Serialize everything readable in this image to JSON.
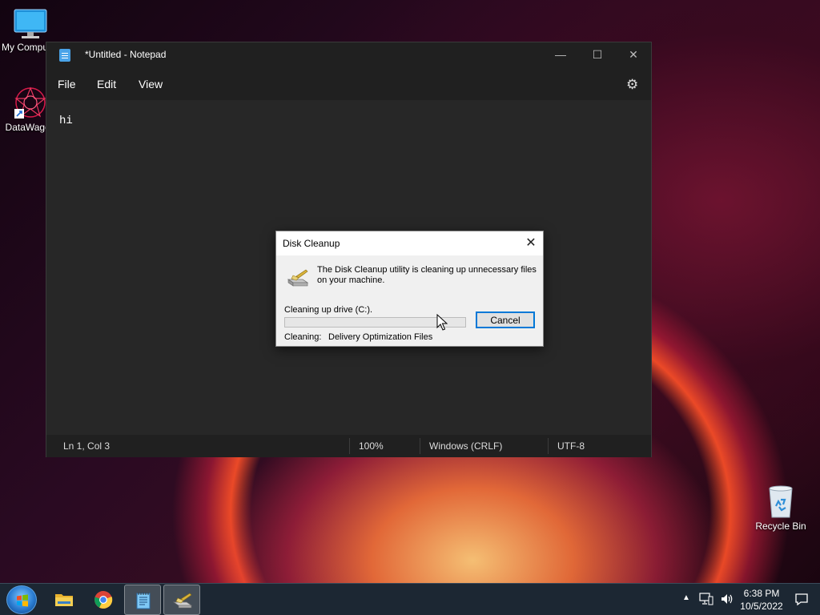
{
  "desktop": {
    "icons": [
      {
        "label": "My Computer",
        "icon": "computer-icon"
      },
      {
        "label": "DataWagon",
        "icon": "datawagon-icon"
      },
      {
        "label": "Recycle Bin",
        "icon": "recycle-bin-icon"
      }
    ]
  },
  "notepad": {
    "title": "*Untitled - Notepad",
    "icon": "notepad-icon",
    "window_controls": {
      "minimize": "—",
      "maximize": "☐",
      "close": "✕"
    },
    "menu": [
      "File",
      "Edit",
      "View"
    ],
    "settings_icon": "gear-icon",
    "content": "hi",
    "status": {
      "position": "Ln 1, Col 3",
      "zoom": "100%",
      "line_ending": "Windows (CRLF)",
      "encoding": "UTF-8"
    }
  },
  "disk_cleanup": {
    "title": "Disk Cleanup",
    "close": "✕",
    "message": "The Disk Cleanup utility is cleaning up unnecessary files on your machine.",
    "drive_label": "Cleaning up drive  (C:).",
    "progress": 0,
    "cleaning_label": "Cleaning:",
    "cleaning_value": "Delivery Optimization Files",
    "cancel_label": "Cancel"
  },
  "taskbar": {
    "start": "start-button",
    "apps": [
      {
        "name": "File Explorer",
        "icon": "folder-icon",
        "active": false
      },
      {
        "name": "Google Chrome",
        "icon": "chrome-icon",
        "active": false
      },
      {
        "name": "Notepad",
        "icon": "notepad-icon",
        "active": true
      },
      {
        "name": "Disk Cleanup",
        "icon": "disk-cleanup-icon",
        "active": true
      }
    ],
    "tray": {
      "chevron": "▲",
      "time": "6:38 PM",
      "date": "10/5/2022"
    }
  },
  "colors": {
    "notepad_bg": "#272727",
    "progress_fill": "#06b025",
    "accent": "#0078d7"
  }
}
